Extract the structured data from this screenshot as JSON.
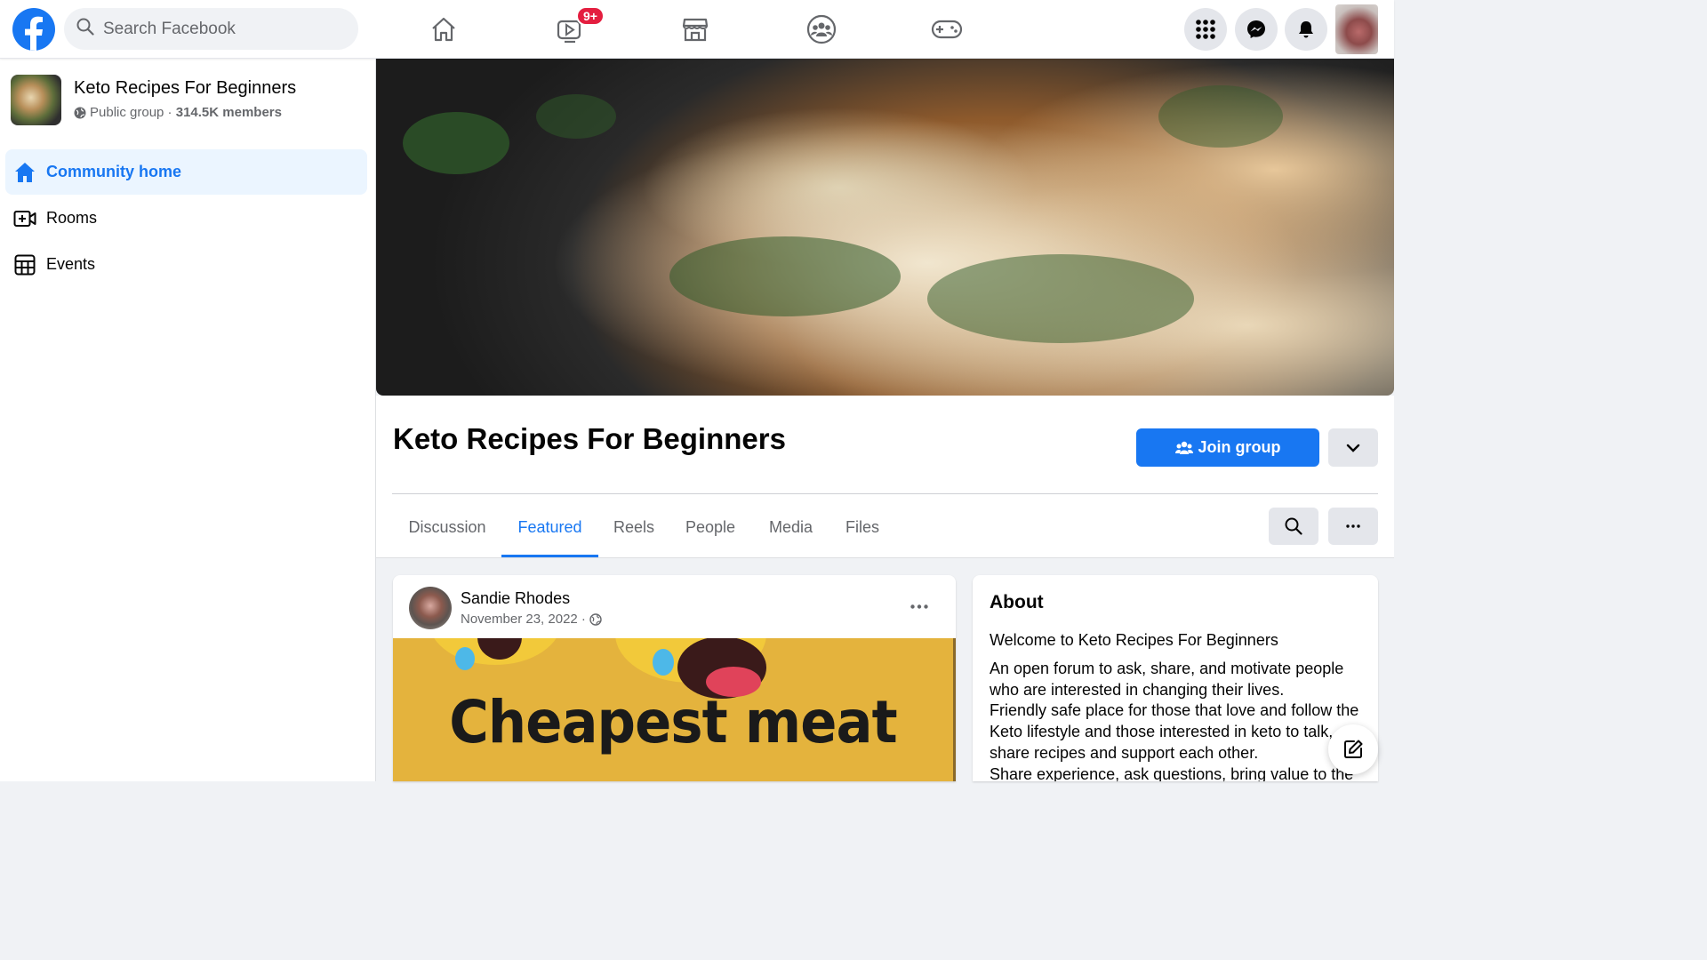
{
  "topbar": {
    "search_placeholder": "Search Facebook",
    "video_badge": "9+",
    "icons": [
      "facebook-logo",
      "home-icon",
      "watch-icon",
      "marketplace-icon",
      "groups-icon",
      "gaming-icon",
      "menu-grid-icon",
      "messenger-icon",
      "notifications-icon"
    ]
  },
  "sidebar": {
    "group_name": "Keto Recipes For Beginners",
    "privacy": "Public group",
    "separator": " · ",
    "members": "314.5K members",
    "items": [
      {
        "label": "Community home",
        "icon": "home-icon",
        "active": true
      },
      {
        "label": "Rooms",
        "icon": "video-plus-icon",
        "active": false
      },
      {
        "label": "Events",
        "icon": "calendar-grid-icon",
        "active": false
      }
    ]
  },
  "group": {
    "title": "Keto Recipes For Beginners",
    "join_label": "Join group",
    "tabs": [
      {
        "label": "Discussion",
        "active": false
      },
      {
        "label": "Featured",
        "active": true
      },
      {
        "label": "Reels",
        "active": false
      },
      {
        "label": "People",
        "active": false
      },
      {
        "label": "Media",
        "active": false
      },
      {
        "label": "Files",
        "active": false
      }
    ]
  },
  "post": {
    "author": "Sandie Rhodes",
    "date": "November 23, 2022",
    "date_separator": " · ",
    "image_text": "Cheapest meat"
  },
  "about": {
    "title": "About",
    "welcome": "Welcome to Keto Recipes For Beginners",
    "description": "An open forum to ask, share, and motivate people who are interested in changing their lives.\nFriendly safe place for those that love and follow the Keto lifestyle and those interested in keto to talk, share recipes and support each other.\nShare experience, ask questions, bring value to the"
  },
  "colors": {
    "brand": "#1877f2",
    "badge": "#e41e3f",
    "active_bg": "#ebf5ff"
  }
}
